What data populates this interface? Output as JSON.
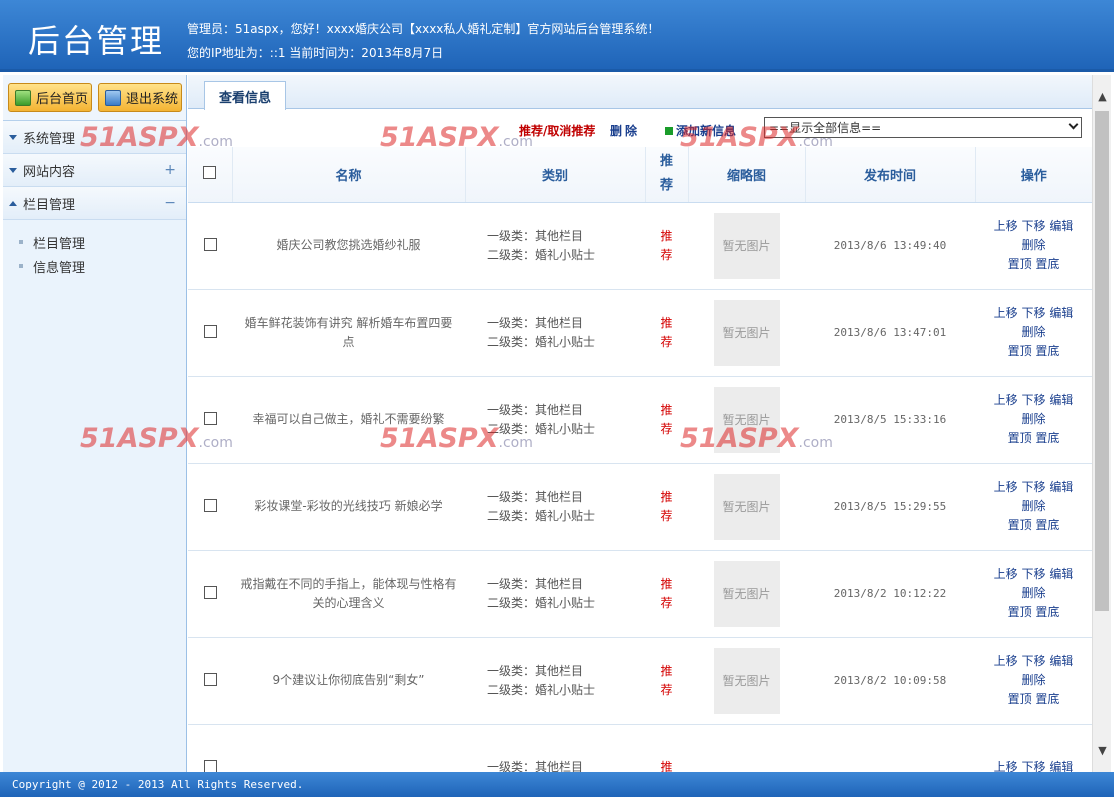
{
  "header": {
    "title": "后台管理",
    "welcome": "管理员：51aspx，您好！xxxx婚庆公司【xxxx私人婚礼定制】官方网站后台管理系统！",
    "ip_line": "您的IP地址为：::1 当前时间为：2013年8月7日"
  },
  "sidebar": {
    "home_label": "后台首页",
    "exit_label": "退出系统",
    "menus": [
      {
        "label": "系统管理",
        "toggle": ""
      },
      {
        "label": "网站内容",
        "toggle": "+"
      },
      {
        "label": "栏目管理",
        "toggle": "−"
      }
    ],
    "sub_items": [
      "栏目管理",
      "信息管理"
    ]
  },
  "main": {
    "tab_label": "查看信息",
    "action_recommend": "推荐/取消推荐",
    "action_delete": "删除",
    "action_add": "添加新信息",
    "filter_value": "==显示全部信息==",
    "columns": {
      "name": "名称",
      "category": "类别",
      "recommend_1": "推",
      "recommend_2": "荐",
      "thumb": "缩略图",
      "time": "发布时间",
      "ops": "操作"
    },
    "rows": [
      {
        "name": "婚庆公司教您挑选婚纱礼服",
        "cat1": "一级类：其他栏目",
        "cat2": "二级类：婚礼小贴士",
        "rec1": "推",
        "rec2": "荐",
        "thumb": "暂无图片",
        "time": "2013/8/6 13:49:40"
      },
      {
        "name": "婚车鲜花装饰有讲究 解析婚车布置四要点",
        "cat1": "一级类：其他栏目",
        "cat2": "二级类：婚礼小贴士",
        "rec1": "推",
        "rec2": "荐",
        "thumb": "暂无图片",
        "time": "2013/8/6 13:47:01"
      },
      {
        "name": "幸福可以自己做主，婚礼不需要纷繁",
        "cat1": "一级类：其他栏目",
        "cat2": "二级类：婚礼小贴士",
        "rec1": "推",
        "rec2": "荐",
        "thumb": "暂无图片",
        "time": "2013/8/5 15:33:16"
      },
      {
        "name": "彩妆课堂-彩妆的光线技巧 新娘必学",
        "cat1": "一级类：其他栏目",
        "cat2": "二级类：婚礼小贴士",
        "rec1": "推",
        "rec2": "荐",
        "thumb": "暂无图片",
        "time": "2013/8/5 15:29:55"
      },
      {
        "name": "戒指戴在不同的手指上，能体现与性格有关的心理含义",
        "cat1": "一级类：其他栏目",
        "cat2": "二级类：婚礼小贴士",
        "rec1": "推",
        "rec2": "荐",
        "thumb": "暂无图片",
        "time": "2013/8/2 10:12:22"
      },
      {
        "name": "9个建议让你彻底告别“剩女”",
        "cat1": "一级类：其他栏目",
        "cat2": "二级类：婚礼小贴士",
        "rec1": "推",
        "rec2": "荐",
        "thumb": "暂无图片",
        "time": "2013/8/2 10:09:58"
      },
      {
        "name": "",
        "cat1": "一级类：其他栏目",
        "cat2": "",
        "rec1": "推",
        "rec2": "",
        "thumb": "",
        "time": ""
      }
    ],
    "ops": {
      "up": "上移",
      "down": "下移",
      "edit": "编辑",
      "delete": "删除",
      "top": "置顶",
      "bottom": "置底"
    }
  },
  "footer": {
    "copyright": "Copyright @ 2012 - 2013 All Rights Reserved."
  },
  "watermark": {
    "text": "51ASPX",
    "suffix": ".com"
  }
}
